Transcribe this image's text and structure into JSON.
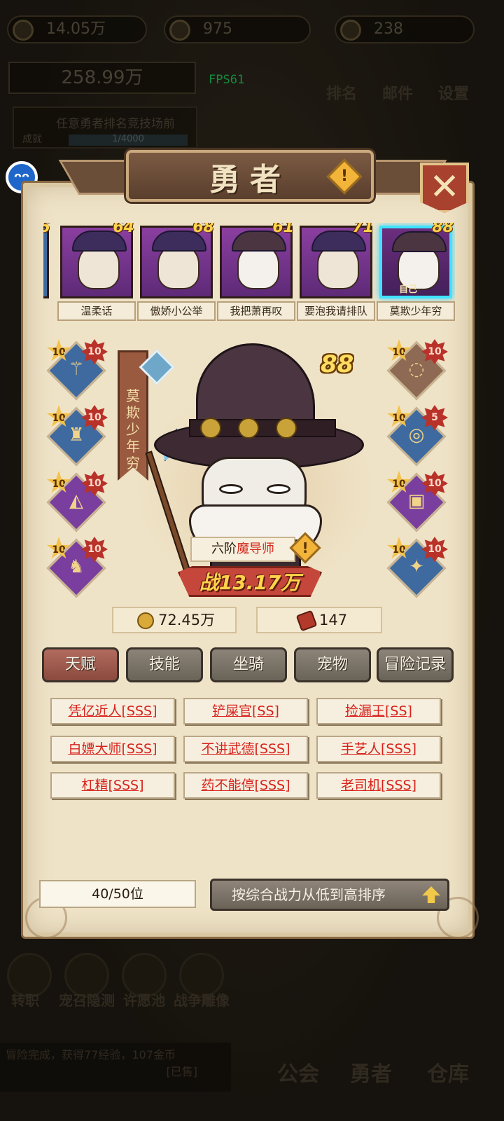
{
  "hud": {
    "gold": "14.05万",
    "gems": "975",
    "energy": "238",
    "total_money": "258.99万",
    "fps": "FPS61",
    "rank_label": "排名",
    "mail_label": "邮件",
    "settings_label": "设置",
    "quest_text": "任意勇者排名竞技场前",
    "quest_tag": "成就",
    "quest_progress": "1/4000",
    "side_badge": "ᴖᴖ"
  },
  "bottom_hud": {
    "buttons": [
      "转职",
      "宠召隐测",
      "许愿池",
      "战争雕像"
    ],
    "log_line1": "冒险完成，获得77经验，107金币",
    "log_tag": "[已售]",
    "tabs": [
      "公会",
      "勇者",
      "仓库"
    ]
  },
  "panel": {
    "title": "勇者",
    "info_icon": "!",
    "close_icon": "✕",
    "roster": [
      {
        "name": "温柔话",
        "level": "64",
        "type": "girl"
      },
      {
        "name": "傲娇小公举",
        "level": "68",
        "type": "girl"
      },
      {
        "name": "我把萧再叹",
        "level": "61",
        "type": "wizard"
      },
      {
        "name": "要泡我请排队",
        "level": "71",
        "type": "girl"
      },
      {
        "name": "莫欺少年穷",
        "level": "88",
        "type": "wizard",
        "selected": true,
        "tag": "自己"
      }
    ],
    "roster_partial_level": "5",
    "hero": {
      "name": "莫欺少年穷",
      "level": "88",
      "class_prefix": "六阶",
      "class_name": "魔导师",
      "power_prefix": "战",
      "power": "13.17万",
      "gold": "72.45万",
      "tickets": "147"
    },
    "equipment_left": [
      {
        "icon": "staff-icon",
        "star": "10",
        "enhance": "10",
        "rarity": "blue"
      },
      {
        "icon": "cape-icon",
        "star": "10",
        "enhance": "10",
        "rarity": "blue"
      },
      {
        "icon": "hood-icon",
        "star": "10",
        "enhance": "10",
        "rarity": "purple"
      },
      {
        "icon": "boots-icon",
        "star": "10",
        "enhance": "10",
        "rarity": "purple"
      }
    ],
    "equipment_right": [
      {
        "icon": "necklace-icon",
        "star": "10",
        "enhance": "10",
        "rarity": "brown"
      },
      {
        "icon": "ring-icon",
        "star": "10",
        "enhance": "5",
        "rarity": "blue"
      },
      {
        "icon": "robe-icon",
        "star": "10",
        "enhance": "10",
        "rarity": "purple"
      },
      {
        "icon": "amulet-icon",
        "star": "10",
        "enhance": "10",
        "rarity": "blue"
      }
    ],
    "tabs": [
      "天赋",
      "技能",
      "坐骑",
      "宠物",
      "冒险记录"
    ],
    "active_tab": "天赋",
    "talents": [
      "凭亿近人[SSS]",
      "铲屎官[SS]",
      "捡漏王[SS]",
      "白嫖大师[SSS]",
      "不讲武德[SSS]",
      "手艺人[SSS]",
      "杠精[SSS]",
      "药不能停[SSS]",
      "老司机[SSS]"
    ],
    "hero_count": "40/50位",
    "sort_label": "按综合战力从低到高排序"
  },
  "colors": {
    "panel_bg": "#efe3c7",
    "talent_text": "#d8211c",
    "selected_border": "#40e3ff",
    "level_gold": "#ffd34a"
  }
}
